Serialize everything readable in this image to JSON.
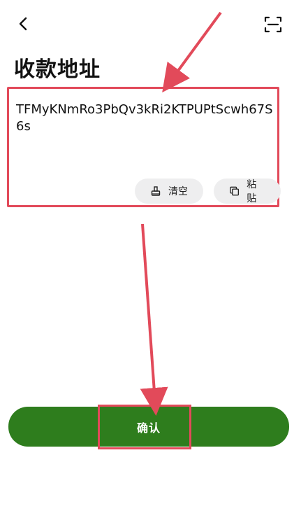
{
  "header": {
    "back_icon": "chevron-left-icon",
    "scan_icon": "scan-icon",
    "title": "收款地址"
  },
  "address": {
    "value": "TFMyKNmRo3PbQv3kRi2KTPUPtScwh67S6s",
    "clear_label": "清空",
    "clear_icon": "broom-icon",
    "paste_label": "粘贴",
    "paste_icon": "copy-icon"
  },
  "confirm": {
    "label": "确认"
  },
  "colors": {
    "accent": "#2e7d1d",
    "annotation": "#e24a5a",
    "pill_bg": "#eeeeef"
  }
}
